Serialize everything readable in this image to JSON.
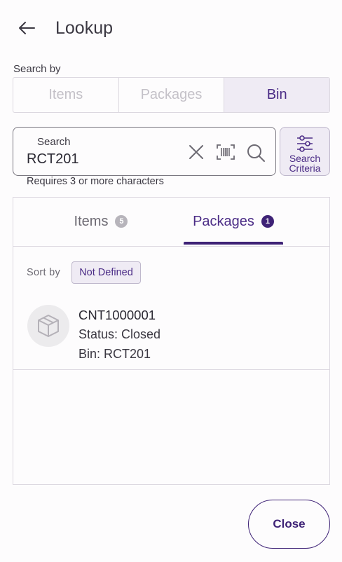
{
  "header": {
    "title": "Lookup",
    "back_icon": "arrow-left-icon"
  },
  "search_by": {
    "label": "Search by",
    "options": [
      {
        "label": "Items",
        "selected": false
      },
      {
        "label": "Packages",
        "selected": false
      },
      {
        "label": "Bin",
        "selected": true
      }
    ]
  },
  "search": {
    "label": "Search",
    "value": "RCT201",
    "hint": "Requires 3 or more characters",
    "icons": [
      "close-icon",
      "barcode-icon",
      "search-icon"
    ]
  },
  "criteria_button": {
    "line1": "Search",
    "line2": "Criteria",
    "icon": "sliders-icon"
  },
  "tabs": [
    {
      "label": "Items",
      "count": "5",
      "active": false
    },
    {
      "label": "Packages",
      "count": "1",
      "active": true
    }
  ],
  "sort": {
    "label": "Sort by",
    "value": "Not Defined"
  },
  "results": [
    {
      "title": "CNT1000001",
      "status": "Status: Closed",
      "bin": "Bin: RCT201",
      "icon": "package-box-icon"
    }
  ],
  "footer": {
    "close_label": "Close"
  },
  "colors": {
    "accent": "#3e2276",
    "accent_light": "#efebf4",
    "border": "#dcd8e0"
  }
}
